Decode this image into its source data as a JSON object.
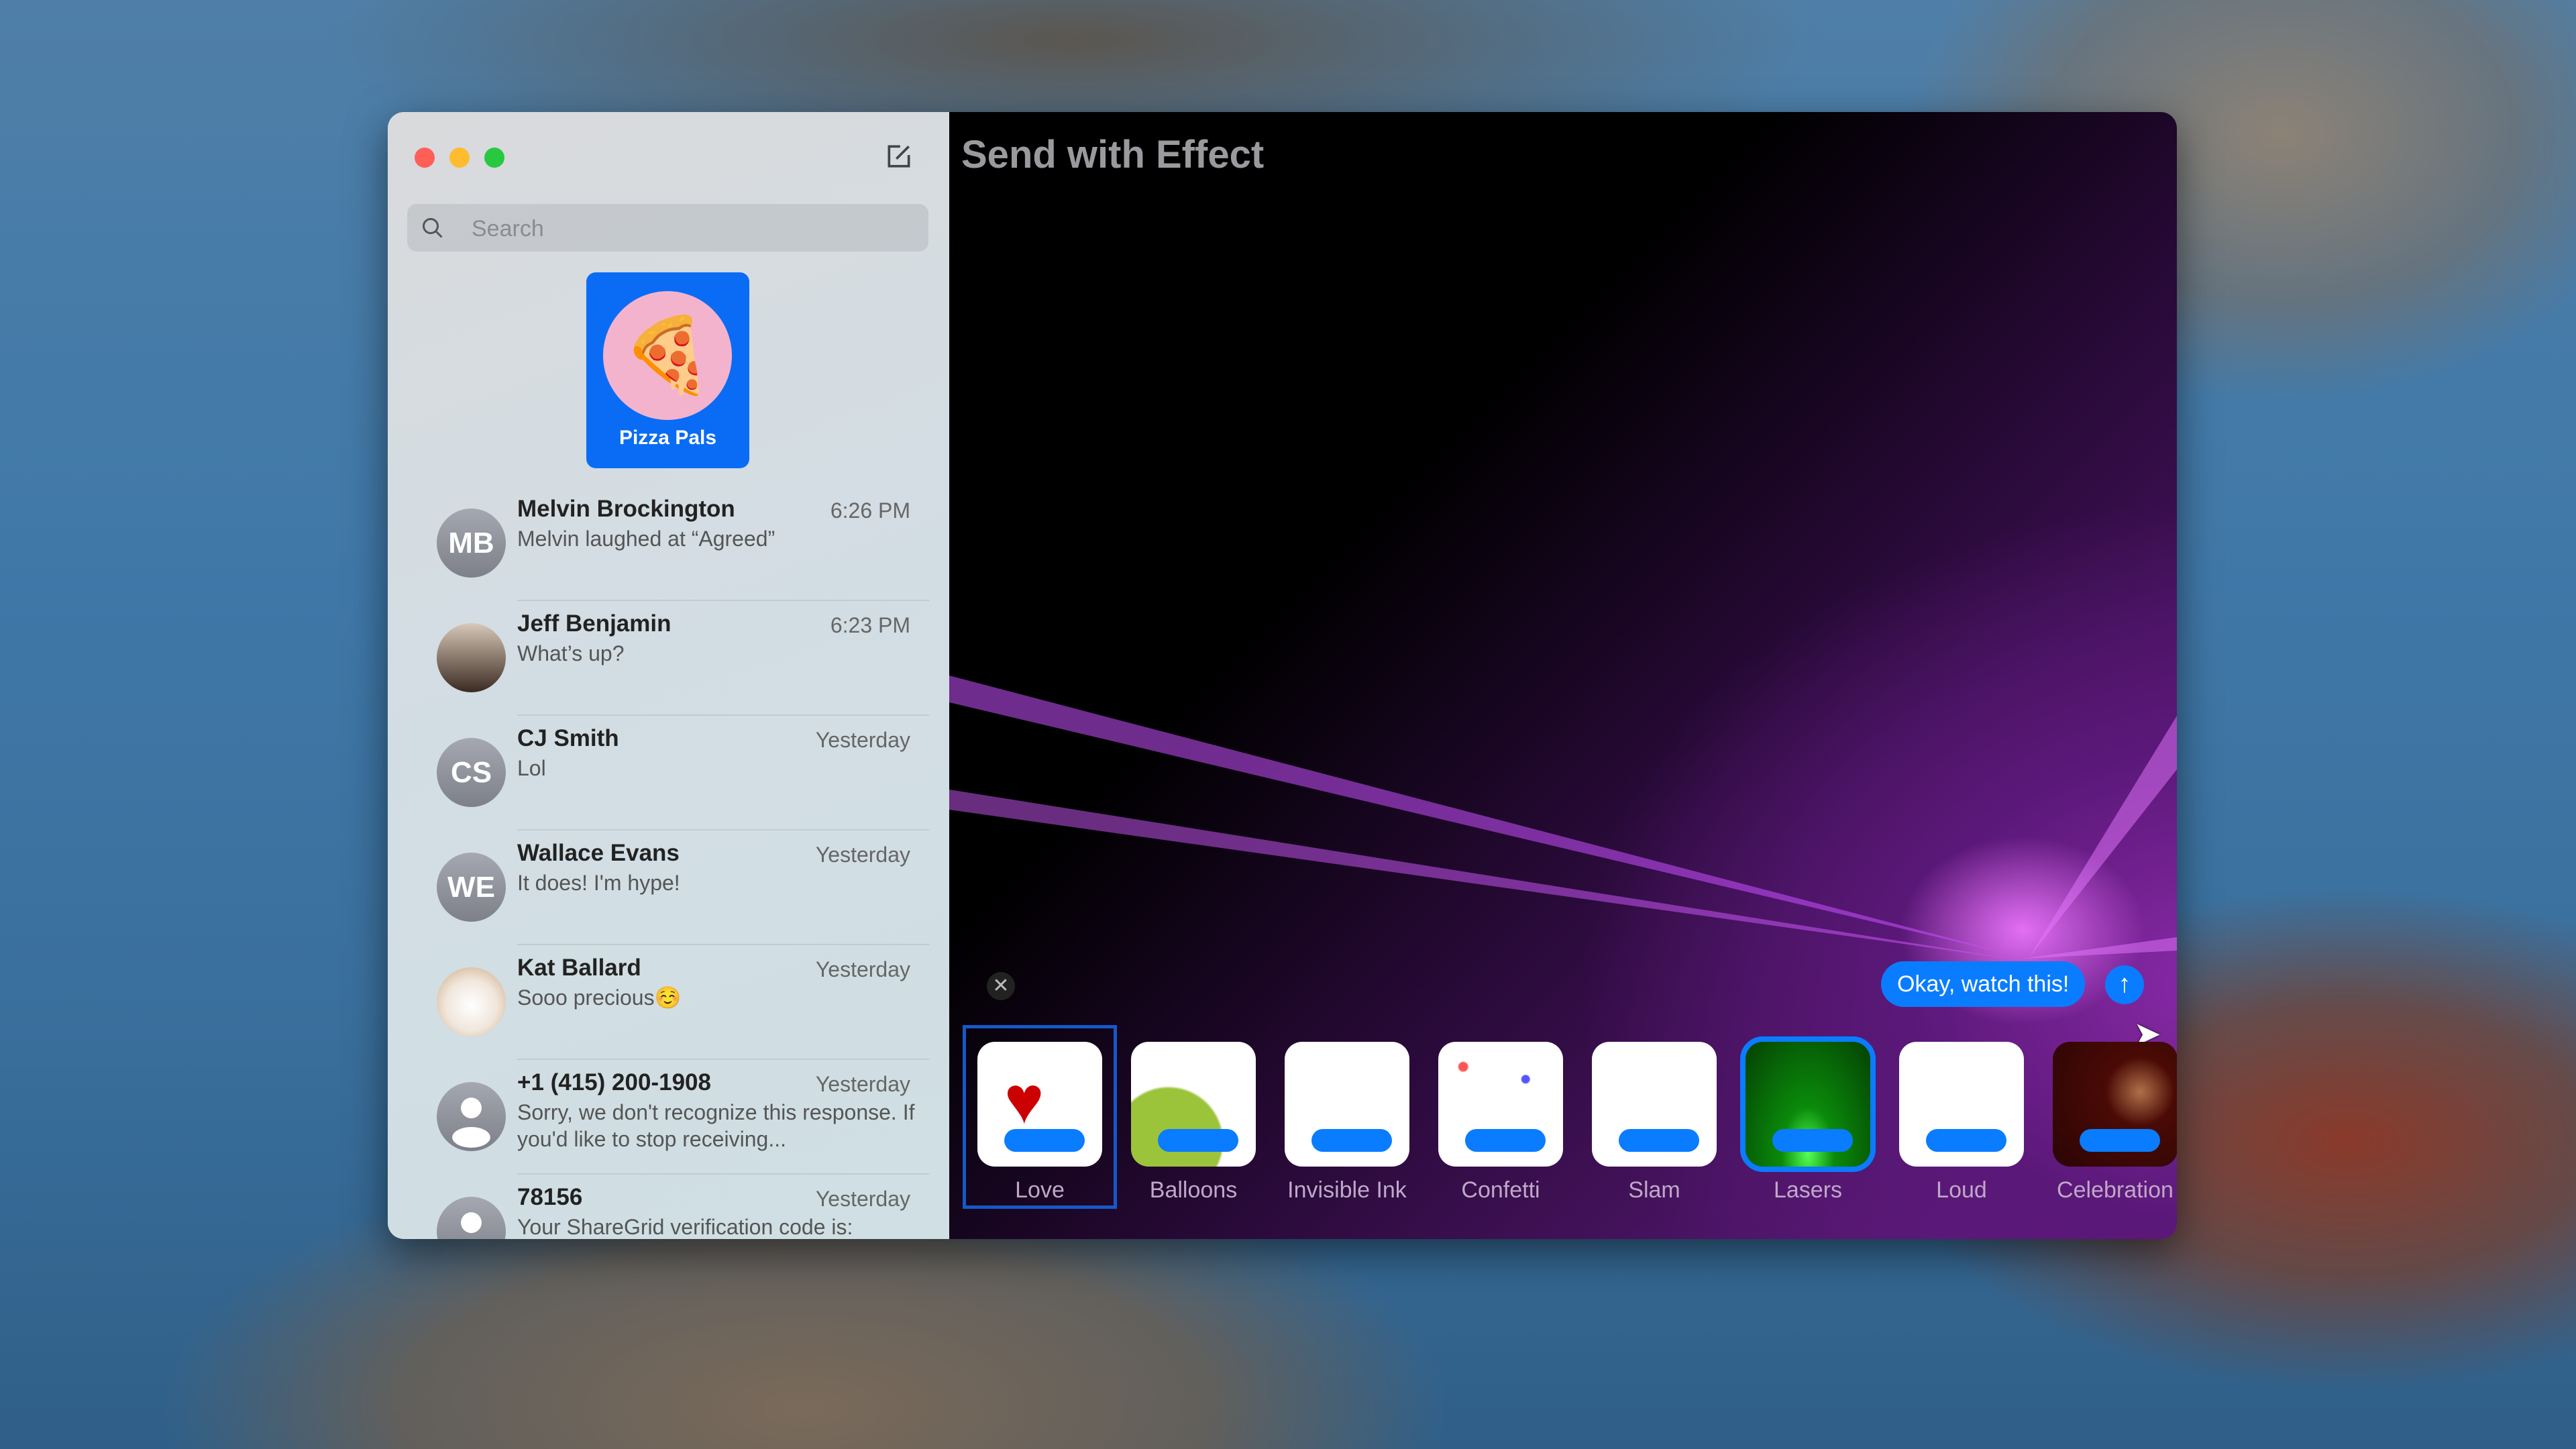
{
  "window": {
    "title": "Send with Effect"
  },
  "sidebar": {
    "search_placeholder": "Search",
    "pinned": {
      "label": "Pizza Pals",
      "emoji": "🍕"
    },
    "conversations": [
      {
        "initials": "MB",
        "name": "Melvin Brockington",
        "time": "6:26 PM",
        "preview": "Melvin laughed at “Agreed”"
      },
      {
        "initials": "",
        "name": "Jeff Benjamin",
        "time": "6:23 PM",
        "preview": "What’s up?"
      },
      {
        "initials": "CS",
        "name": "CJ Smith",
        "time": "Yesterday",
        "preview": "Lol"
      },
      {
        "initials": "WE",
        "name": "Wallace Evans",
        "time": "Yesterday",
        "preview": "It does! I'm hype!"
      },
      {
        "initials": "",
        "name": "Kat Ballard",
        "time": "Yesterday",
        "preview": "Sooo precious☺️"
      },
      {
        "initials": "",
        "name": "+1 (415) 200-1908",
        "time": "Yesterday",
        "preview": "Sorry, we don't recognize this response. If you'd like to stop receiving..."
      },
      {
        "initials": "",
        "name": "78156",
        "time": "Yesterday",
        "preview": "Your ShareGrid verification code is:"
      }
    ]
  },
  "composer": {
    "message": "Okay, watch this!",
    "send_icon": "arrow-up-icon",
    "close_icon": "close-icon"
  },
  "effects": {
    "selected": "Love",
    "items": [
      "Love",
      "Balloons",
      "Invisible Ink",
      "Confetti",
      "Slam",
      "Lasers",
      "Loud",
      "Celebration"
    ]
  },
  "colors": {
    "accent": "#0a7cff",
    "close": "#ff5f57",
    "minimize": "#febc2e",
    "zoom": "#28c840"
  }
}
